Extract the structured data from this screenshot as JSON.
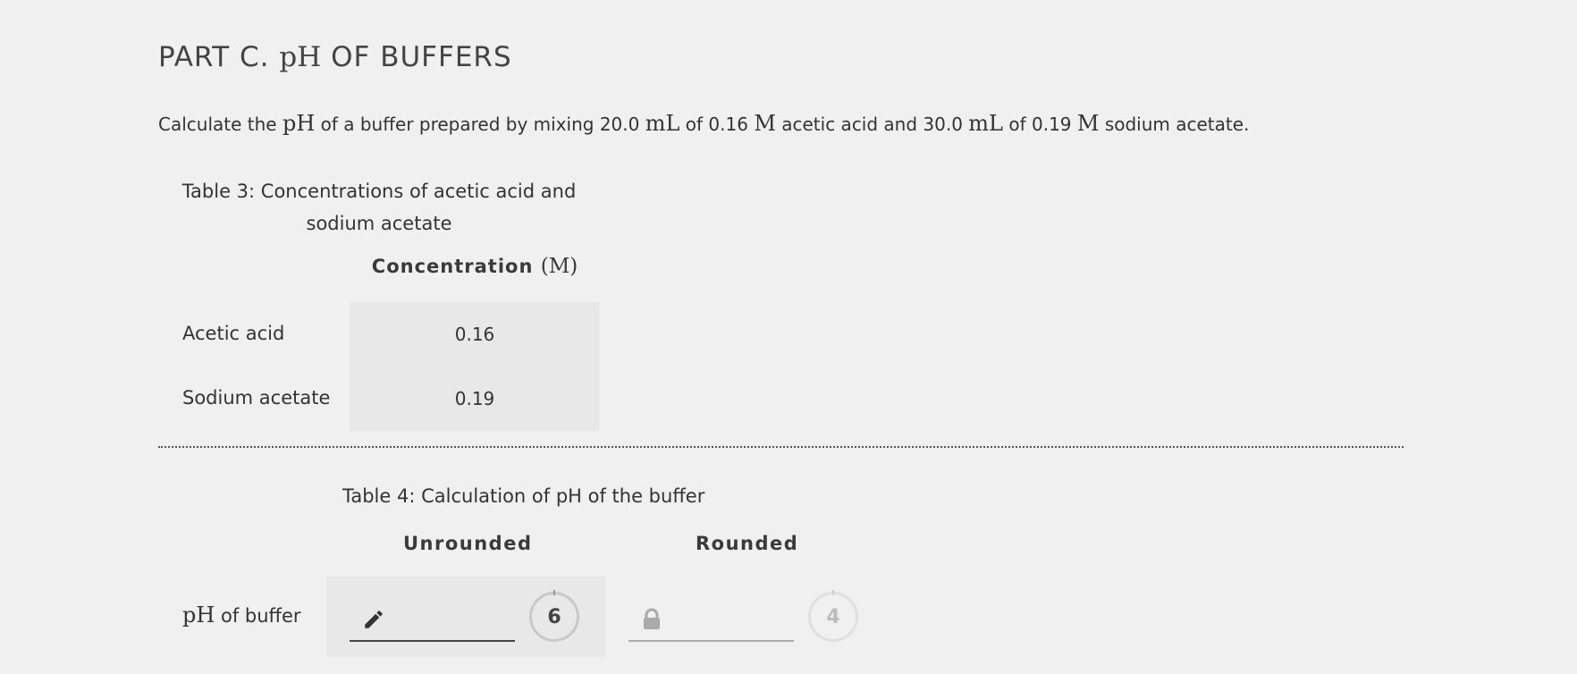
{
  "part": {
    "prefix": "PART C.",
    "ph": "pH",
    "suffix": "OF BUFFERS"
  },
  "question": {
    "t1": "Calculate the",
    "ph": "pH",
    "t2": "of a buffer prepared by mixing 20.0",
    "ml1": "mL",
    "t3": "of 0.16",
    "m1": "M",
    "t4": "acetic acid and 30.0",
    "ml2": "mL",
    "t5": "of 0.19",
    "m2": "M",
    "t6": "sodium acetate."
  },
  "table3": {
    "caption": "Table 3: Concentrations of acetic acid and sodium acetate",
    "column_header": "Concentration",
    "column_unit": "(M)",
    "rows": [
      {
        "label": "Acetic acid",
        "value": "0.16"
      },
      {
        "label": "Sodium acetate",
        "value": "0.19"
      }
    ]
  },
  "table4": {
    "caption": "Table 4: Calculation of pH of the buffer",
    "headers": {
      "unrounded": "Unrounded",
      "rounded": "Rounded"
    },
    "row": {
      "ph": "pH",
      "label": "of buffer",
      "unrounded_value": "",
      "unrounded_sigfigs": "6",
      "rounded_value": "",
      "rounded_sigfigs": "4"
    }
  },
  "icons": {
    "edit": "pencil-icon",
    "locked": "lock-icon"
  },
  "colors": {
    "background": "#f0f0f0",
    "cell_background": "#e8e8e8",
    "text": "#333333"
  }
}
